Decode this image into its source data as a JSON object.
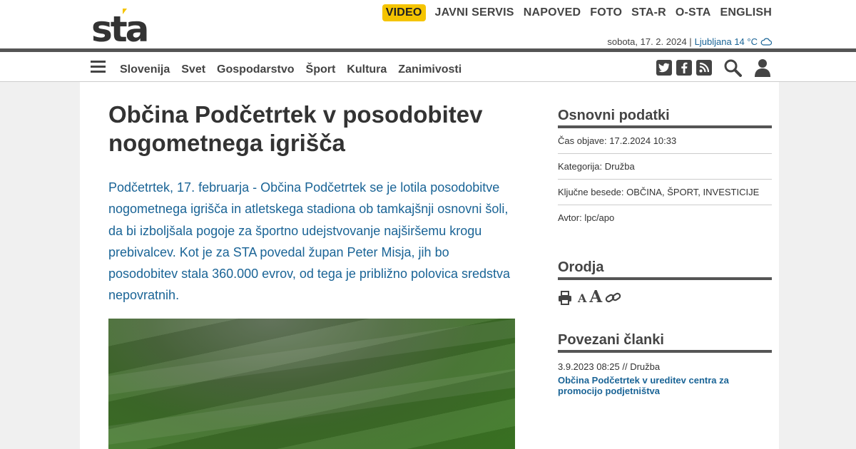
{
  "header": {
    "logo_text": "sta",
    "top_nav": [
      "VIDEO",
      "JAVNI SERVIS",
      "NAPOVED",
      "FOTO",
      "STA-R",
      "O-STA",
      "ENGLISH"
    ],
    "date": "sobota, 17. 2. 2024 |",
    "weather": "Ljubljana 14 °C",
    "weather_icon": "cloud-icon",
    "accent_color": "#f5c400",
    "link_color": "#1a6496"
  },
  "main_nav": {
    "categories": [
      "Slovenija",
      "Svet",
      "Gospodarstvo",
      "Šport",
      "Kultura",
      "Zanimivosti"
    ],
    "social": [
      {
        "name": "twitter",
        "glyph": "t"
      },
      {
        "name": "facebook",
        "glyph": "f"
      },
      {
        "name": "rss",
        "glyph": "≋"
      }
    ]
  },
  "article": {
    "title": "Občina Podčetrtek v posodobitev nogometnega igrišča",
    "lead": "Podčetrtek, 17. februarja - Občina Podčetrtek se je lotila posodobitve nogometnega igrišča in atletskega stadiona ob tamkajšnji osnovni šoli, da bi izboljšala pogoje za športno udejstvovanje najširšemu krogu prebivalcev. Kot je za STA povedal župan Peter Misja, jih bo posodobitev stala 360.000 evrov, od tega je približno polovica sredstva nepovratnih."
  },
  "sidebar": {
    "basic_title": "Osnovni podatki",
    "published": "Čas objave: 17.2.2024 10:33",
    "category": "Kategorija: Družba",
    "keywords": "Ključne besede: OBČINA, ŠPORT, INVESTICIJE",
    "author": "Avtor: lpc/apo",
    "tools_title": "Orodja",
    "font_small": "A",
    "font_large": "A",
    "related_title": "Povezani članki",
    "related": [
      {
        "meta": "3.9.2023 08:25 // Družba",
        "title": "Občina Podčetrtek v ureditev centra za promocijo podjetništva"
      }
    ]
  }
}
